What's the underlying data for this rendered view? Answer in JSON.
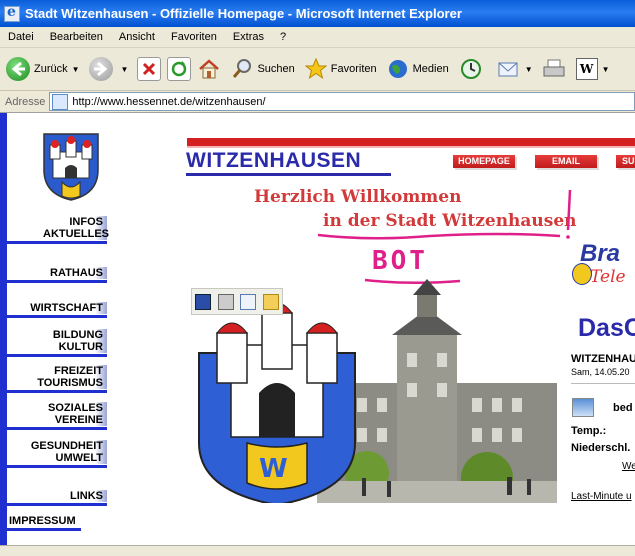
{
  "window": {
    "title": "Stadt Witzenhausen - Offizielle Homepage - Microsoft Internet Explorer"
  },
  "menu": [
    "Datei",
    "Bearbeiten",
    "Ansicht",
    "Favoriten",
    "Extras",
    "?"
  ],
  "toolbar": {
    "back_label": "Zurück",
    "search_label": "Suchen",
    "favorites_label": "Favoriten",
    "media_label": "Medien"
  },
  "address": {
    "label": "Adresse",
    "url": "http://www.hessennet.de/witzenhausen/"
  },
  "page": {
    "heading": "WITZENHAUSEN",
    "top_buttons": [
      "HOMEPAGE",
      "EMAIL",
      "SU"
    ],
    "welcome_line1": "Herzlich Willkommen",
    "welcome_line2": "in der Stadt Witzenhausen",
    "annotation": "BOT",
    "nav": [
      {
        "label": "INFOS AKTUELLES"
      },
      {
        "label": "RATHAUS"
      },
      {
        "label": "WIRTSCHAFT"
      },
      {
        "label": "BILDUNG KULTUR"
      },
      {
        "label": "FREIZEIT TOURISMUS"
      },
      {
        "label": "SOZIALES VEREINE"
      },
      {
        "label": "GESUNDHEIT UMWELT"
      },
      {
        "label": "LINKS"
      },
      {
        "label": "IMPRESSUM"
      }
    ],
    "brand_line1": "Bra",
    "brand_line2": "Tele",
    "das_text": "DasC",
    "weather": {
      "title": "WITZENHAU",
      "date": "Sam, 14.05.20",
      "condition": "bed",
      "temp_label": "Temp.:",
      "rain_label": "Niederschl.",
      "link1": "We",
      "link2": "Last-Minute u"
    }
  },
  "colors": {
    "nav_blue": "#1f2fd0",
    "heading_blue": "#2a2aaa",
    "accent_red": "#d42020",
    "welcome_red": "#d23a3a",
    "annotation_pink": "#e0208a"
  }
}
